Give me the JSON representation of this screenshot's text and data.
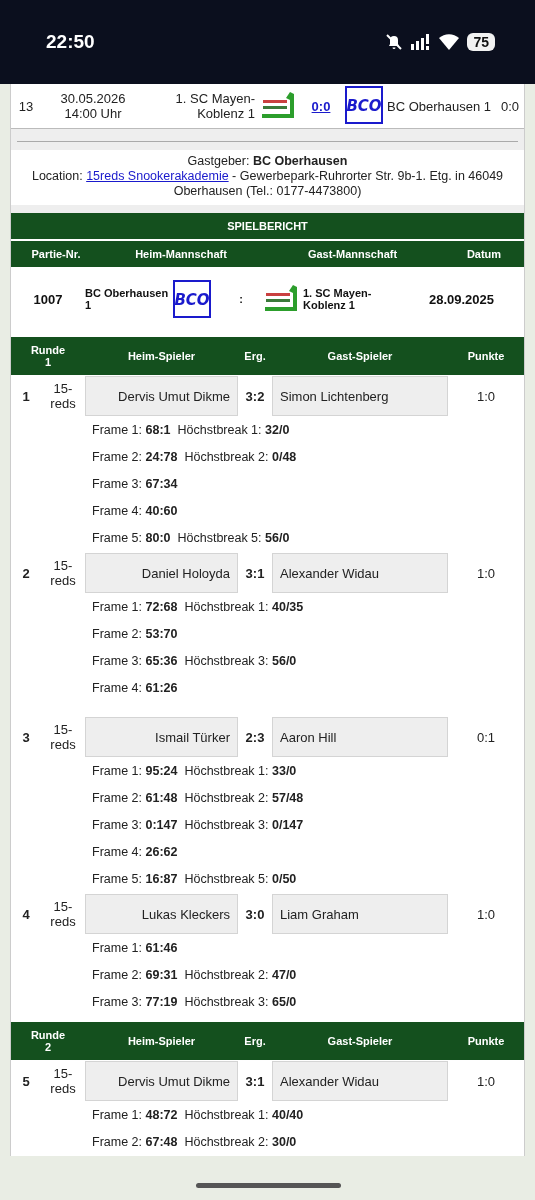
{
  "status_bar": {
    "time": "22:50",
    "battery": "75"
  },
  "top_match": {
    "number": "13",
    "date": "30.05.2026",
    "time": "14:00 Uhr",
    "home": "1. SC Mayen-Koblenz 1",
    "score": "0:0",
    "guest_logo": "BCO",
    "guest": "BC Oberhausen 1",
    "points": "0:0"
  },
  "host": {
    "text": "Gastgeber: **BC Oberhausen**",
    "location_label": "Location:",
    "location_link": "15reds Snookerakademie",
    "location_rest": "- Gewerbepark-Ruhrorter Str. 9b-1. Etg. in 46049 Oberhausen (Tel.: 0177-4473800)"
  },
  "report": {
    "title": "SPIELBERICHT",
    "columns": [
      "Partie-Nr.",
      "Heim-Mannschaft",
      "Gast-Mannschaft",
      "Datum"
    ],
    "number": "1007",
    "home": "BC Oberhausen 1",
    "home_logo": "BCO",
    "separator": ":",
    "guest": "1. SC Mayen-Koblenz 1",
    "date": "28.09.2025"
  },
  "rounds": [
    {
      "columns": [
        "Runde 1",
        "Heim-Spieler",
        "Erg.",
        "Gast-Spieler",
        "Punkte"
      ],
      "games": [
        {
          "number": "1",
          "format": "15-reds",
          "home": "Dervis Umut Dikme",
          "result": "3:2",
          "guest": "Simon Lichtenberg",
          "points": "1:0",
          "frames": [
            "Frame 1: **68:1**  Höchstbreak 1: **32/0**",
            "Frame 2: **24:78**  Höchstbreak 2: **0/48**",
            "Frame 3: **67:34**",
            "Frame 4: **40:60**",
            "Frame 5: **80:0**  Höchstbreak 5: **56/0**"
          ]
        },
        {
          "number": "2",
          "format": "15-reds",
          "home": "Daniel Holoyda",
          "result": "3:1",
          "guest": "Alexander Widau",
          "points": "1:0",
          "frames": [
            "Frame 1: **72:68**  Höchstbreak 1: **40/35**",
            "Frame 2: **53:70**",
            "Frame 3: **65:36**  Höchstbreak 3: **56/0**",
            "Frame 4: **61:26**"
          ]
        },
        {
          "number": "3",
          "format": "15-reds",
          "home": "Ismail Türker",
          "result": "2:3",
          "guest": "Aaron Hill",
          "points": "0:1",
          "frames": [
            "Frame 1: **95:24**  Höchstbreak 1: **33/0**",
            "Frame 2: **61:48**  Höchstbreak 2: **57/48**",
            "Frame 3: **0:147**  Höchstbreak 3: **0/147**",
            "Frame 4: **26:62**",
            "Frame 5: **16:87**  Höchstbreak 5: **0/50**"
          ]
        },
        {
          "number": "4",
          "format": "15-reds",
          "home": "Lukas Kleckers",
          "result": "3:0",
          "guest": "Liam Graham",
          "points": "1:0",
          "frames": [
            "Frame 1: **61:46**",
            "Frame 2: **69:31**  Höchstbreak 2: **47/0**",
            "Frame 3: **77:19**  Höchstbreak 3: **65/0**"
          ]
        }
      ]
    },
    {
      "columns": [
        "Runde 2",
        "Heim-Spieler",
        "Erg.",
        "Gast-Spieler",
        "Punkte"
      ],
      "games": [
        {
          "number": "5",
          "format": "15-reds",
          "home": "Dervis Umut Dikme",
          "result": "3:1",
          "guest": "Alexander Widau",
          "points": "1:0",
          "frames": [
            "Frame 1: **48:72**  Höchstbreak 1: **40/40**",
            "Frame 2: **67:48**  Höchstbreak 2: **30/0**"
          ]
        }
      ]
    }
  ]
}
